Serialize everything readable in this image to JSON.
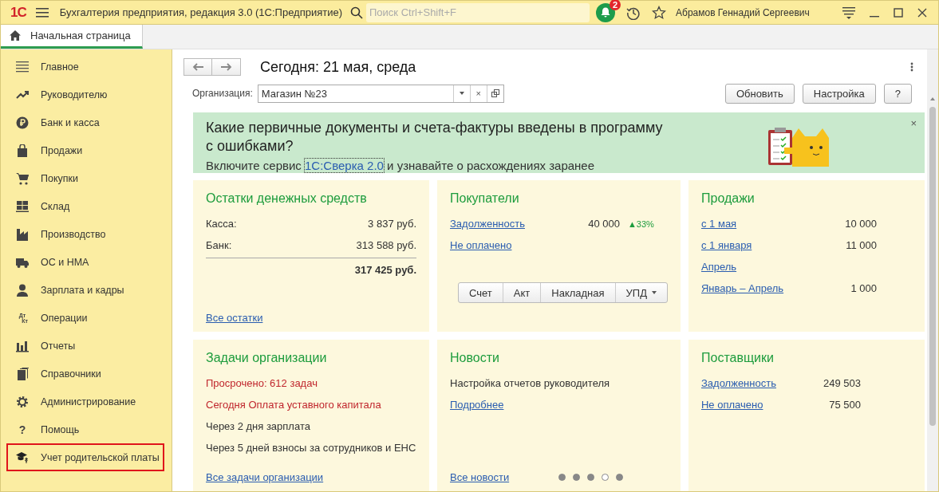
{
  "app": {
    "logo": "1С",
    "title": "Бухгалтерия предприятия, редакция 3.0  (1С:Предприятие)",
    "search": {
      "placeholder": "Поиск Ctrl+Shift+F"
    },
    "notifications": "2",
    "user": "Абрамов Геннадий Сергеевич"
  },
  "tabs": [
    {
      "label": "Начальная страница",
      "selected": true
    }
  ],
  "sidebar": {
    "items": [
      {
        "label": "Главное",
        "highlighted": false
      },
      {
        "label": "Руководителю",
        "highlighted": false
      },
      {
        "label": "Банк и касса",
        "highlighted": false
      },
      {
        "label": "Продажи",
        "highlighted": false
      },
      {
        "label": "Покупки",
        "highlighted": false
      },
      {
        "label": "Склад",
        "highlighted": false
      },
      {
        "label": "Производство",
        "highlighted": false
      },
      {
        "label": "ОС и НМА",
        "highlighted": false
      },
      {
        "label": "Зарплата и кадры",
        "highlighted": false
      },
      {
        "label": "Операции",
        "highlighted": false,
        "icon_text": [
          "Дт",
          "Кт"
        ]
      },
      {
        "label": "Отчеты",
        "highlighted": false
      },
      {
        "label": "Справочники",
        "highlighted": false
      },
      {
        "label": "Администрирование",
        "highlighted": false
      },
      {
        "label": "Помощь",
        "highlighted": false,
        "icon_text": [
          "?"
        ]
      },
      {
        "label": "Учет родительской платы",
        "highlighted": true
      }
    ]
  },
  "page": {
    "title": "Сегодня: 21 мая, среда",
    "organization": {
      "label": "Организация:",
      "value": "Магазин №23",
      "clear": "×"
    },
    "buttons": [
      "Обновить",
      "Настройка",
      "?"
    ]
  },
  "banner": {
    "heading": "Какие первичные документы и счета-фактуры введены в программу с ошибками?",
    "text_before": "Включите сервис ",
    "link": "1С:Сверка 2.0",
    "text_after": " и узнавайте о расхождениях заранее",
    "close": "×"
  },
  "cards": [
    {
      "kind": "money",
      "title": "Остатки денежных средств",
      "rows": [
        {
          "label": "Касса:",
          "link": false,
          "value": "3 837 руб."
        },
        {
          "label": "Банк:",
          "link": false,
          "value": "313 588 руб."
        }
      ],
      "total": "317 425 руб.",
      "footer_link": "Все остатки"
    },
    {
      "kind": "buyers",
      "title": "Покупатели",
      "rows": [
        {
          "label": "Задолженность",
          "link": true,
          "value": "40 000",
          "trend": "▲33%"
        },
        {
          "label": "Не оплачено",
          "link": true
        }
      ],
      "doc_buttons": [
        {
          "label": "Счет",
          "dropdown": false
        },
        {
          "label": "Акт",
          "dropdown": false
        },
        {
          "label": "Накладная",
          "dropdown": false
        },
        {
          "label": "УПД",
          "dropdown": true
        }
      ]
    },
    {
      "kind": "list",
      "title": "Продажи",
      "rows": [
        {
          "label": "с 1 мая",
          "link": true,
          "value": "10 000"
        },
        {
          "label": "с 1 января",
          "link": true,
          "value": "11 000"
        },
        {
          "label": "Апрель",
          "link": true
        },
        {
          "label": "Январь – Апрель",
          "link": true,
          "value": "1 000"
        }
      ]
    },
    {
      "kind": "tasks",
      "title": "Задачи организации",
      "rows": [
        {
          "label": "Просрочено: 612 задач",
          "link": false,
          "urgent": true
        },
        {
          "label": "Сегодня Оплата уставного капитала",
          "link": false,
          "urgent": true
        },
        {
          "label": "Через 2 дня зарплата",
          "link": false,
          "urgent": false
        },
        {
          "label": "Через 5 дней взносы за сотрудников и ЕНС",
          "link": false,
          "urgent": false
        }
      ],
      "footer_link": "Все задачи организации"
    },
    {
      "kind": "news",
      "title": "Новости",
      "rows": [
        {
          "label": "Настройка отчетов руководителя",
          "link": false
        },
        {
          "label": "Подробнее",
          "link": true
        }
      ],
      "footer_link": "Все новости",
      "dots": [
        {
          "selected": false
        },
        {
          "selected": false
        },
        {
          "selected": false
        },
        {
          "selected": true
        },
        {
          "selected": false
        }
      ]
    },
    {
      "kind": "suppliers",
      "title": "Поставщики",
      "rows": [
        {
          "label": "Задолженность",
          "link": true,
          "value": "249 503"
        },
        {
          "label": "Не оплачено",
          "link": true,
          "value": "75 500"
        }
      ]
    }
  ]
}
